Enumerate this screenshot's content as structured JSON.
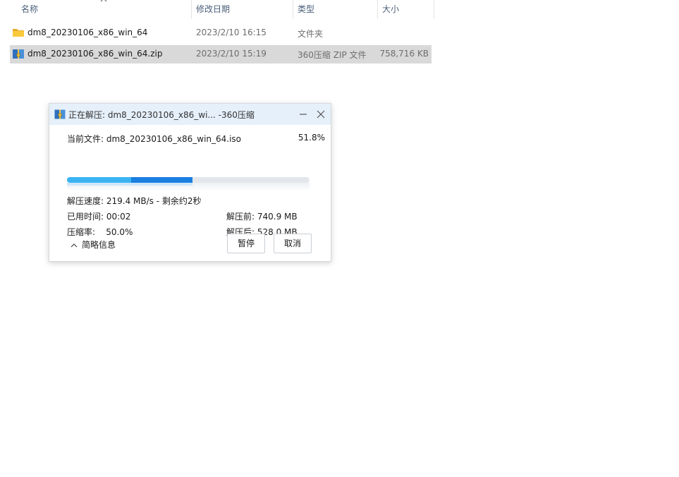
{
  "columns": {
    "name": "名称",
    "date": "修改日期",
    "type": "类型",
    "size": "大小"
  },
  "files": [
    {
      "name": "dm8_20230106_x86_win_64",
      "date": "2023/2/10 16:15",
      "type": "文件夹",
      "size": "",
      "icon": "folder-icon",
      "selected": false
    },
    {
      "name": "dm8_20230106_x86_win_64.zip",
      "date": "2023/2/10 15:19",
      "type": "360压缩 ZIP 文件",
      "size": "758,716 KB",
      "icon": "zip-archive-icon",
      "selected": true
    }
  ],
  "dialog": {
    "title": "正在解压: dm8_20230106_x86_wi... -360压缩",
    "current_file": "当前文件: dm8_20230106_x86_win_64.iso",
    "percent_text": "51.8%",
    "progress": 0.518,
    "speed": "解压速度: 219.4 MB/s   - 剩余约2秒",
    "elapsed": "已用时间: 00:02",
    "before": "解压前: 740.9 MB",
    "ratio": "压缩率:    50.0%",
    "after": "解压后: 528.0 MB",
    "toggle_label": "简略信息",
    "pause_label": "暂停",
    "cancel_label": "取消"
  },
  "colors": {
    "accent": "#1a7fe0",
    "accent_light": "#3bb3f2",
    "title_bar": "#e6f0fb",
    "selection": "#d9d9d9"
  }
}
